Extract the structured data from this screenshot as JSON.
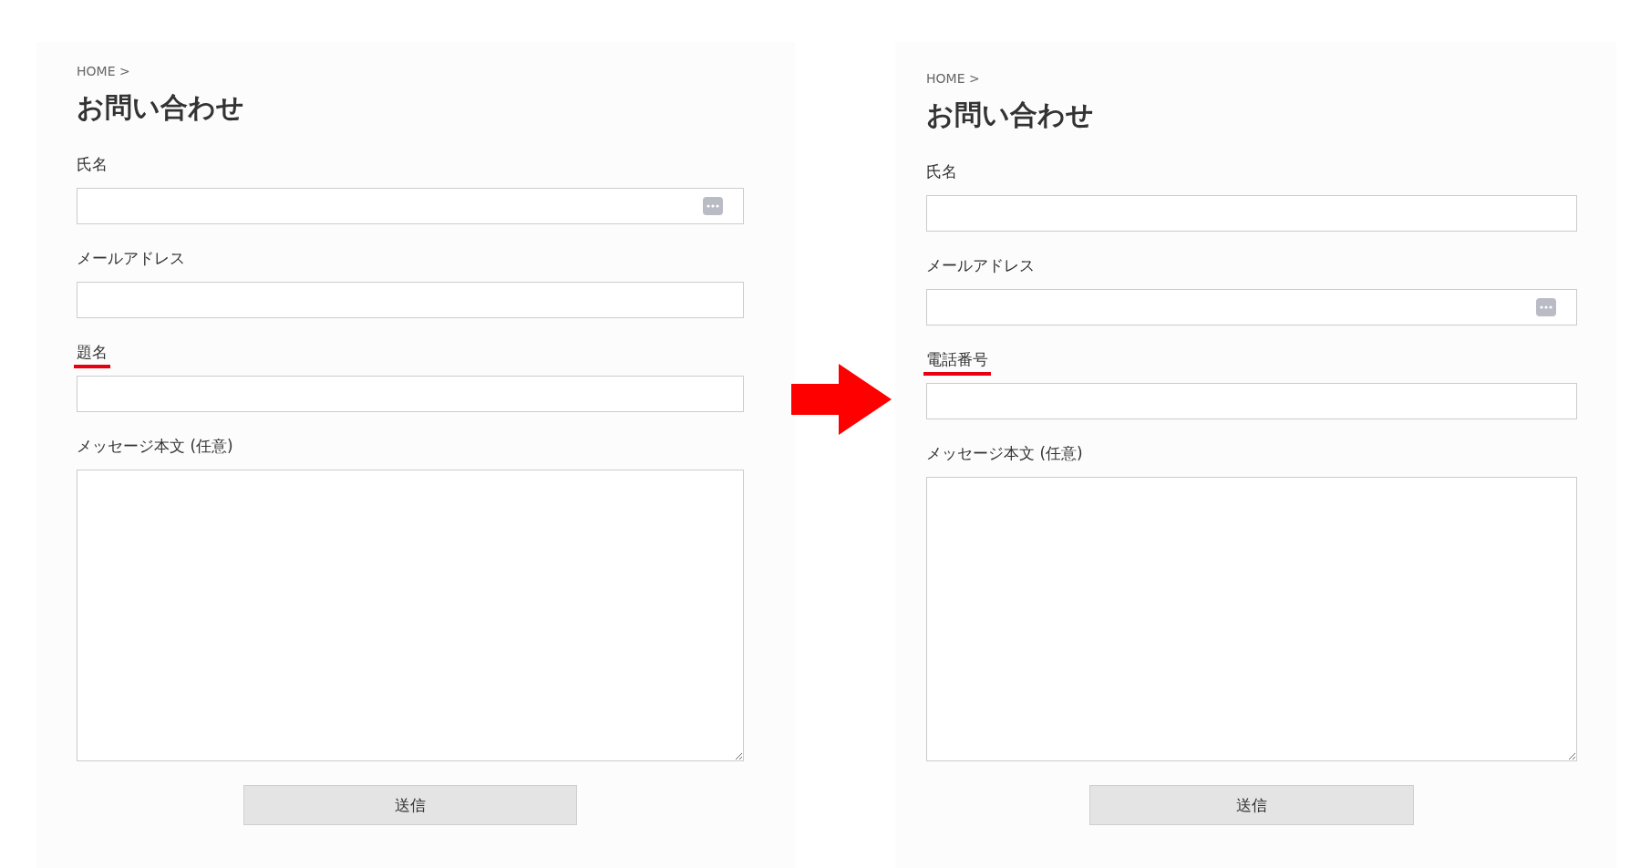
{
  "panels": [
    {
      "breadcrumb": "HOME >",
      "title": "お問い合わせ",
      "fields": [
        {
          "label": "氏名",
          "kind": "input",
          "autofill_icon": true,
          "highlighted": false
        },
        {
          "label": "メールアドレス",
          "kind": "input",
          "autofill_icon": false,
          "highlighted": false
        },
        {
          "label": "題名",
          "kind": "input",
          "autofill_icon": false,
          "highlighted": true
        },
        {
          "label": "メッセージ本文 (任意)",
          "kind": "textarea",
          "highlighted": false
        }
      ],
      "submit": "送信"
    },
    {
      "breadcrumb": "HOME >",
      "title": "お問い合わせ",
      "fields": [
        {
          "label": "氏名",
          "kind": "input",
          "autofill_icon": false,
          "highlighted": false
        },
        {
          "label": "メールアドレス",
          "kind": "input",
          "autofill_icon": true,
          "highlighted": false
        },
        {
          "label": "電話番号",
          "kind": "input",
          "autofill_icon": false,
          "highlighted": true
        },
        {
          "label": "メッセージ本文 (任意)",
          "kind": "textarea",
          "highlighted": false
        }
      ],
      "submit": "送信"
    }
  ]
}
